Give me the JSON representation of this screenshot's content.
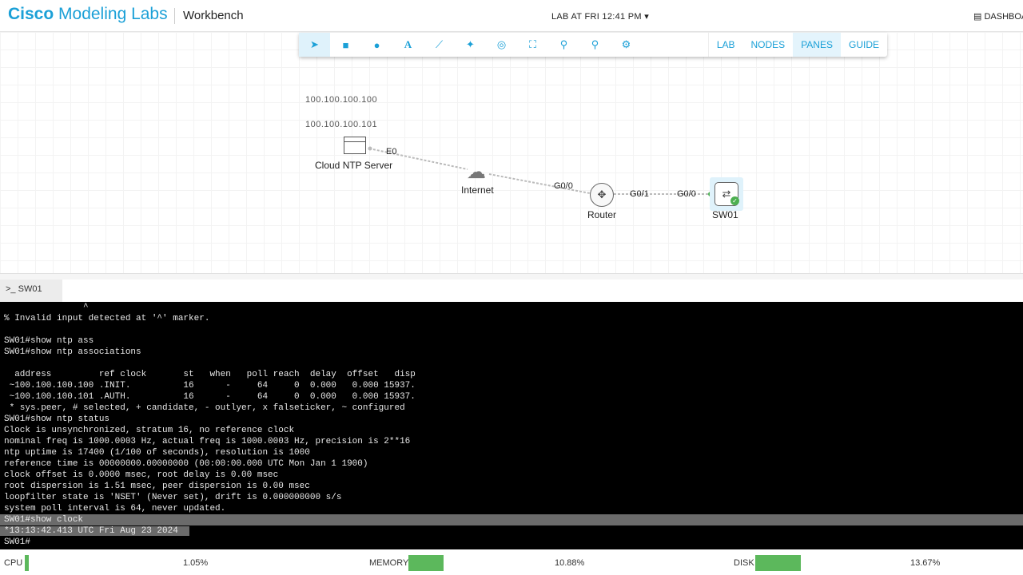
{
  "header": {
    "brand_bold": "Cisco",
    "brand_rest": " Modeling Labs",
    "section": "Workbench",
    "lab_title": "LAB AT FRI 12:41 PM",
    "dashboard": "DASHBOARD"
  },
  "toolbar": {
    "icons": [
      "pointer-icon",
      "rectangle-icon",
      "ellipse-icon",
      "text-icon",
      "line-icon",
      "add-node-icon",
      "center-icon",
      "fit-icon",
      "zoom-out-icon",
      "zoom-in-icon",
      "settings-icon"
    ],
    "menus": [
      "LAB",
      "NODES",
      "PANES",
      "GUIDE"
    ],
    "active_menu": "PANES"
  },
  "topology": {
    "annotations": [
      "100.100.100.100",
      "100.100.100.101"
    ],
    "nodes": {
      "ntp": "Cloud NTP Server",
      "internet": "Internet",
      "router": "Router",
      "sw": "SW01"
    },
    "interfaces": {
      "ntp_e0": "E0",
      "router_g00": "G0/0",
      "router_g01": "G0/1",
      "sw_g00": "G0/0"
    }
  },
  "console": {
    "tab": "SW01",
    "lines": [
      "               ^",
      "% Invalid input detected at '^' marker.",
      "",
      "SW01#show ntp ass",
      "SW01#show ntp associations",
      "",
      "  address         ref clock       st   when   poll reach  delay  offset   disp",
      " ~100.100.100.100 .INIT.          16      -     64     0  0.000   0.000 15937.",
      " ~100.100.100.101 .AUTH.          16      -     64     0  0.000   0.000 15937.",
      " * sys.peer, # selected, + candidate, - outlyer, x falseticker, ~ configured",
      "SW01#show ntp status",
      "Clock is unsynchronized, stratum 16, no reference clock",
      "nominal freq is 1000.0003 Hz, actual freq is 1000.0003 Hz, precision is 2**16",
      "ntp uptime is 17400 (1/100 of seconds), resolution is 1000",
      "reference time is 00000000.00000000 (00:00:00.000 UTC Mon Jan 1 1900)",
      "clock offset is 0.0000 msec, root delay is 0.00 msec",
      "root dispersion is 1.51 msec, peer dispersion is 0.00 msec",
      "loopfilter state is 'NSET' (Never set), drift is 0.000000000 s/s",
      "system poll interval is 64, never updated.",
      "SW01#show clock",
      "*13:13:42.413 UTC Fri Aug 23 2024",
      "SW01#"
    ]
  },
  "status": {
    "cpu_label": "CPU",
    "cpu_value": "1.05%",
    "cpu_pct": 1.05,
    "memory_label": "MEMORY",
    "memory_value": "10.88%",
    "memory_pct": 10.88,
    "disk_label": "DISK",
    "disk_value": "13.67%",
    "disk_pct": 13.67
  },
  "colors": {
    "accent": "#1ba0d7",
    "bar": "#5cb85c"
  }
}
